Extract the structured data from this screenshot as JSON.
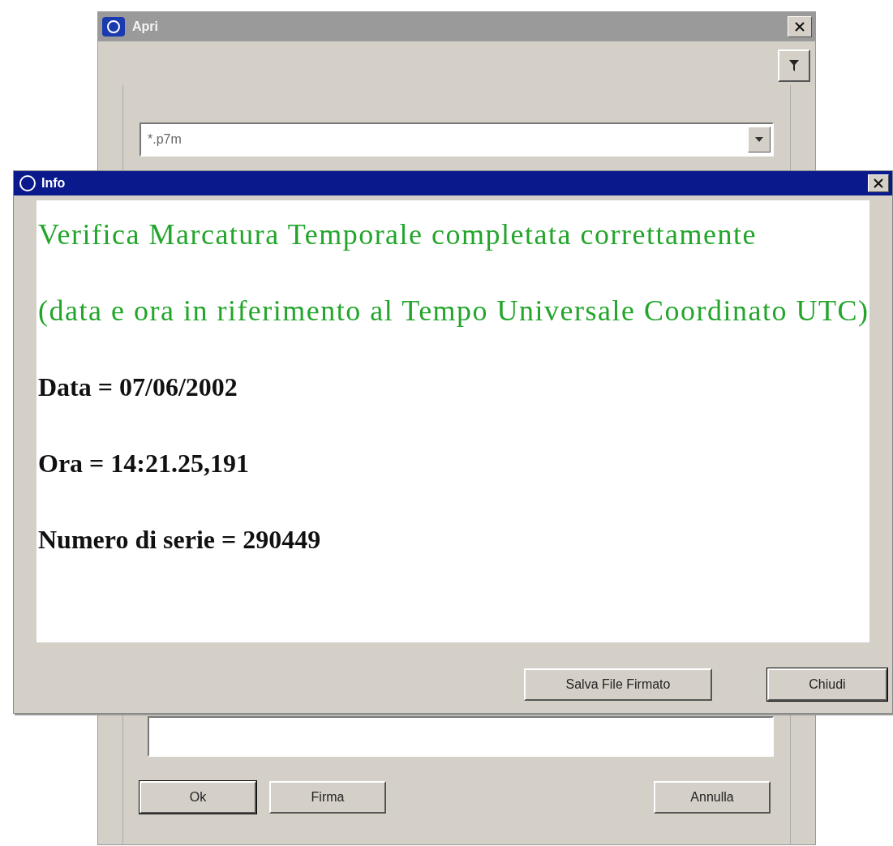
{
  "back_window": {
    "title": "Apri",
    "file_filter": {
      "value": "*.p7m"
    },
    "buttons": [
      {
        "label": "Ok",
        "default": true
      },
      {
        "label": "Firma",
        "default": false
      },
      {
        "label": "Annulla",
        "default": false
      }
    ]
  },
  "info_dialog": {
    "title": "Info",
    "lines": [
      {
        "kind": "status",
        "text": "Verifica Marcatura Temporale completata correttamente"
      },
      {
        "kind": "status",
        "text": "(data e ora in riferimento al Tempo Universale Coordinato UTC)"
      },
      {
        "kind": "detail",
        "text": "Data = 07/06/2002"
      },
      {
        "kind": "detail",
        "text": "Ora = 14:21.25,191"
      },
      {
        "kind": "detail",
        "text": "Numero di serie = 290449"
      }
    ],
    "buttons": [
      {
        "label": "Salva File Firmato",
        "default": false
      },
      {
        "label": "Chiudi",
        "default": true
      }
    ]
  }
}
